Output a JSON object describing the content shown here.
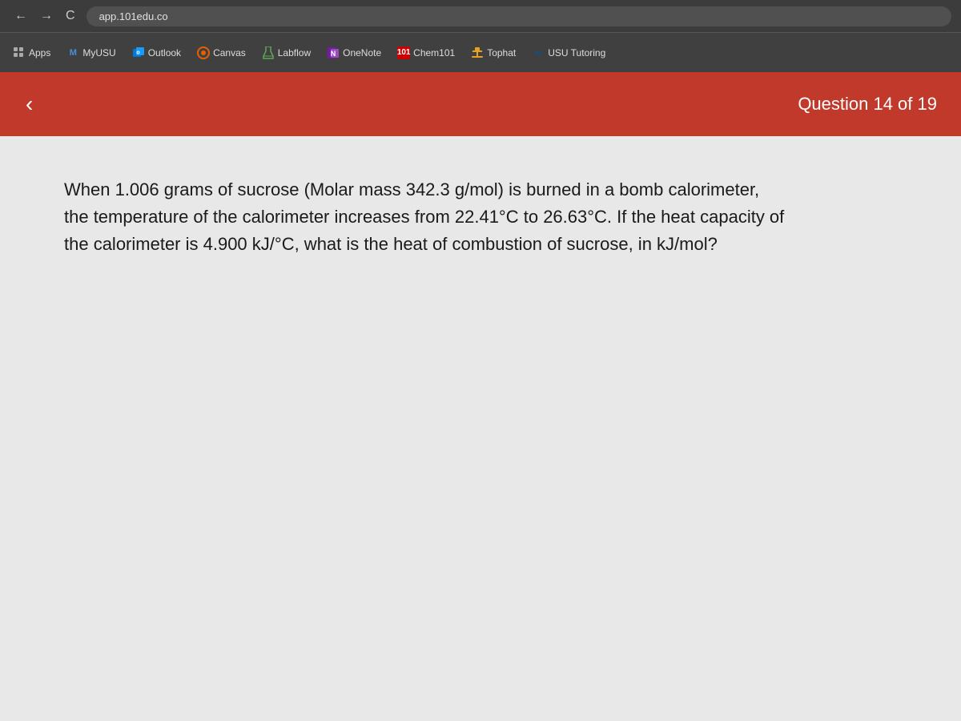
{
  "browser": {
    "url": "app.101edu.co",
    "back_label": "←",
    "forward_label": "→",
    "refresh_label": "C"
  },
  "bookmarks": {
    "items": [
      {
        "id": "apps",
        "label": "Apps",
        "icon_type": "grid"
      },
      {
        "id": "myusu",
        "label": "MyUSU",
        "icon_type": "myusu"
      },
      {
        "id": "outlook",
        "label": "Outlook",
        "icon_type": "outlook"
      },
      {
        "id": "canvas",
        "label": "Canvas",
        "icon_type": "canvas"
      },
      {
        "id": "labflow",
        "label": "Labflow",
        "icon_type": "labflow"
      },
      {
        "id": "onenote",
        "label": "OneNote",
        "icon_type": "onenote"
      },
      {
        "id": "chem101",
        "label": "Chem101",
        "icon_type": "chem"
      },
      {
        "id": "tophat",
        "label": "Tophat",
        "icon_type": "tophat"
      },
      {
        "id": "usu_tutoring",
        "label": "USU Tutoring",
        "icon_type": "usu"
      }
    ]
  },
  "question_header": {
    "back_label": "‹",
    "counter_label": "Question 14 of 19"
  },
  "question": {
    "text": "When 1.006 grams of sucrose (Molar mass 342.3 g/mol) is burned in a bomb calorimeter, the temperature of the calorimeter increases from 22.41°C to 26.63°C. If the heat capacity of the calorimeter is 4.900 kJ/°C, what is the heat of combustion of sucrose, in kJ/mol?"
  }
}
